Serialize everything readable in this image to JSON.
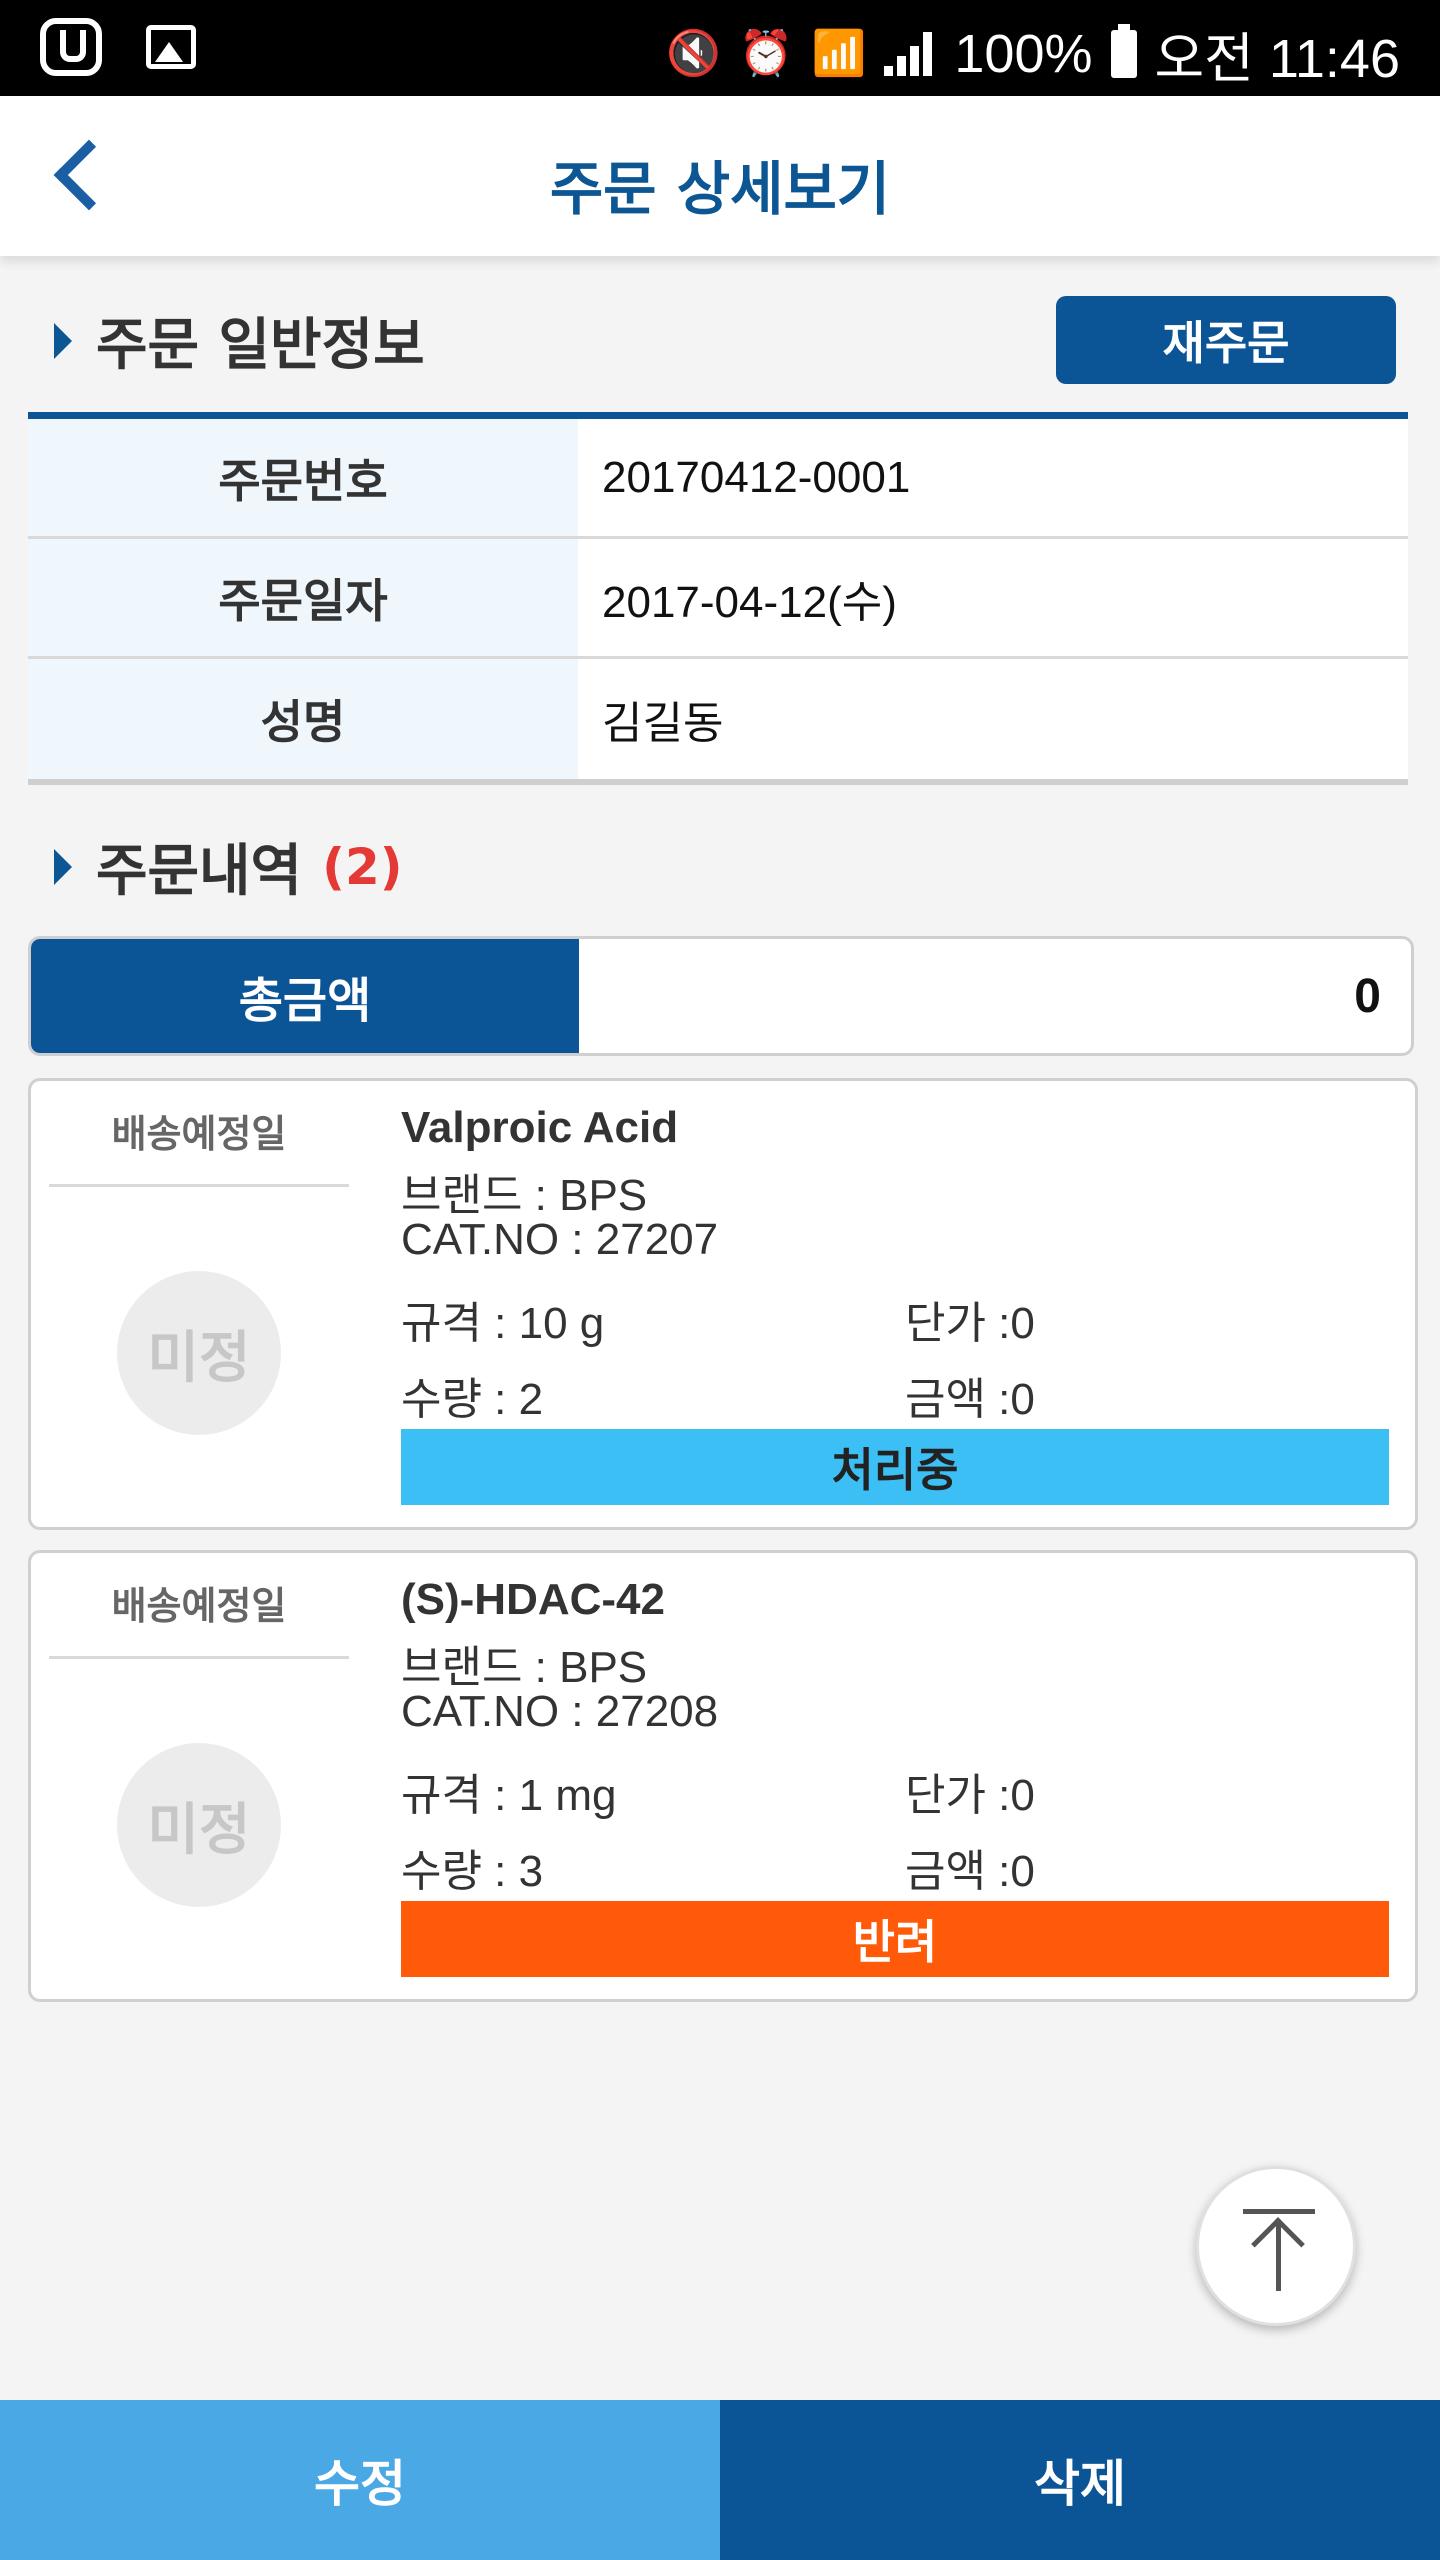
{
  "status_bar": {
    "battery": "100%",
    "time": "오전 11:46"
  },
  "header": {
    "title": "주문 상세보기"
  },
  "general_info": {
    "title": "주문 일반정보",
    "reorder_label": "재주문",
    "rows": [
      {
        "label": "주문번호",
        "value": "20170412-0001"
      },
      {
        "label": "주문일자",
        "value": "2017-04-12(수)"
      },
      {
        "label": "성명",
        "value": "김길동"
      }
    ]
  },
  "order_history": {
    "title": "주문내역",
    "count": "(2)",
    "total_label": "총금액",
    "total_value": "0",
    "items": [
      {
        "ship_label": "배송예정일",
        "ship_value": "미정",
        "name": "Valproic Acid",
        "brand": "브랜드 : BPS",
        "cat_no": "CAT.NO : 27207",
        "spec": "규격 : 10 g",
        "unit_price": "단가 :0",
        "quantity": "수량 : 2",
        "amount": "금액 :0",
        "status": "처리중",
        "status_color": "#3cbff5",
        "status_text_color": "#222222"
      },
      {
        "ship_label": "배송예정일",
        "ship_value": "미정",
        "name": "(S)-HDAC-42",
        "brand": "브랜드 : BPS",
        "cat_no": "CAT.NO : 27208",
        "spec": "규격 : 1 mg",
        "unit_price": "단가 :0",
        "quantity": "수량 : 3",
        "amount": "금액 :0",
        "status": "반려",
        "status_color": "#ff5a0a",
        "status_text_color": "#ffffff"
      }
    ]
  },
  "bottom_bar": {
    "edit_label": "수정",
    "delete_label": "삭제"
  },
  "icons": {
    "back": "chevron-left-icon",
    "scroll_top": "arrow-up-to-top-icon"
  },
  "colors": {
    "primary": "#0b5596",
    "light_blue": "#4aa8e4",
    "accent_red": "#e53935"
  }
}
